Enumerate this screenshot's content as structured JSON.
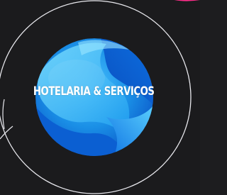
{
  "logo": {
    "title": "HOTELARIA & SERVIÇOS",
    "icon": "globe-swirl-icon",
    "colors": {
      "background": "#1b1b1d",
      "ring": "#e9e9ee",
      "accent_pink": "#ff2d8a",
      "globe_dark": "#0b63d8",
      "globe_mid": "#1a9cf0",
      "globe_light": "#6fd6ff",
      "text": "#ffffff"
    }
  }
}
